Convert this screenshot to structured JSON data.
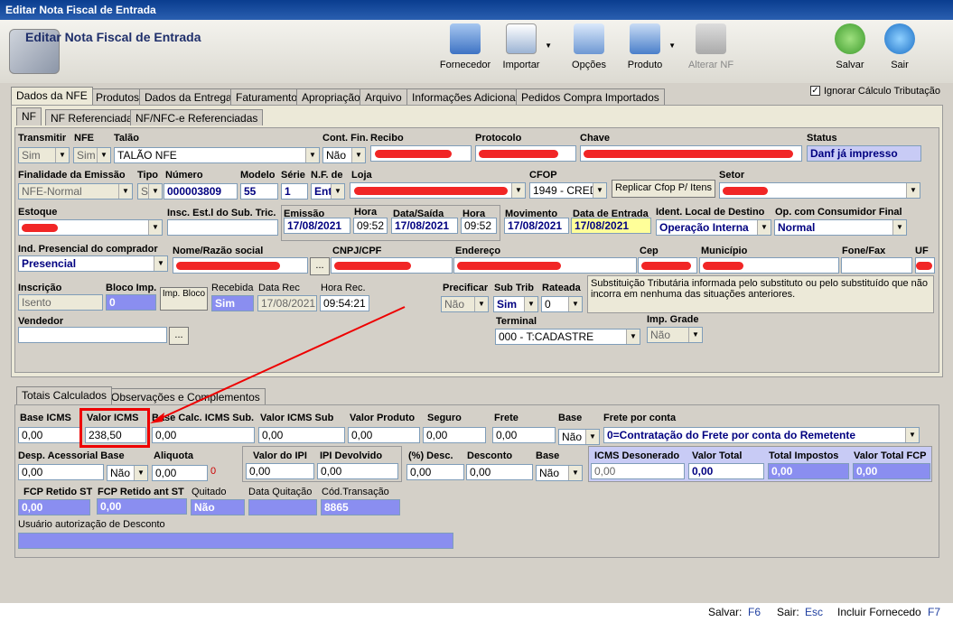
{
  "window": {
    "title": "Editar Nota Fiscal de Entrada",
    "app_name": "Editar Nota Fiscal de Entrada"
  },
  "toolbar": {
    "fornecedor": "Fornecedor",
    "importar": "Importar",
    "opcoes": "Opções",
    "produto": "Produto",
    "alterar_nf": "Alterar NF",
    "salvar": "Salvar",
    "sair": "Sair"
  },
  "main_tabs": [
    "Dados da NFE",
    "Produtos",
    "Dados da Entrega",
    "Faturamento",
    "Apropriação",
    "Arquivo",
    "Informações Adicionais",
    "Pedidos Compra Importados"
  ],
  "ignorar_calc": "Ignorar Cálculo Tributação",
  "sub_tabs": [
    "NF",
    "NF Referenciada",
    "NF/NFC-e Referenciadas"
  ],
  "labels": {
    "transmitir": "Transmitir",
    "nfe": "NFE",
    "talao": "Talão",
    "cont_fin": "Cont. Fin.",
    "recibo": "Recibo",
    "protocolo": "Protocolo",
    "chave": "Chave",
    "status": "Status",
    "finalidade": "Finalidade da Emissão",
    "tipo": "Tipo",
    "numero": "Número",
    "modelo": "Modelo",
    "serie": "Série",
    "nf_de": "N.F. de",
    "loja": "Loja",
    "cfop": "CFOP",
    "setor": "Setor",
    "estoque": "Estoque",
    "insc_sub": "Insc. Est.l do Sub. Tric.",
    "emissao": "Emissão",
    "hora": "Hora",
    "data_saida": "Data/Saída",
    "movimento": "Movimento",
    "data_entrada": "Data de Entrada",
    "ident_local": "Ident. Local de Destino",
    "op_consumidor": "Op. com Consumidor Final",
    "ind_presencial": "Ind. Presencial do comprador",
    "nome": "Nome/Razão social",
    "cnpj": "CNPJ/CPF",
    "endereco": "Endereço",
    "cep": "Cep",
    "municipio": "Município",
    "fone": "Fone/Fax",
    "uf": "UF",
    "inscricao": "Inscrição",
    "bloco_imp": "Bloco Imp.",
    "recebida": "Recebida",
    "data_rec": "Data Rec",
    "hora_rec": "Hora Rec.",
    "precificar": "Precificar",
    "sub_trib": "Sub Trib",
    "rateada": "Rateada",
    "vendedor": "Vendedor",
    "terminal": "Terminal",
    "imp_grade": "Imp. Grade"
  },
  "values": {
    "transmitir": "Sim",
    "nfe": "Sim",
    "talao": "TALÃO NFE",
    "cont_fin": "Não",
    "status": "Danf já impresso",
    "finalidade": "NFE-Normal",
    "tipo": "S",
    "numero": "000003809",
    "modelo": "55",
    "serie": "1",
    "nf_de": "Ent",
    "cfop": "1949 - CREDI",
    "emissao": "17/08/2021",
    "hora_emissao": "09:52",
    "data_saida": "17/08/2021",
    "hora_saida": "09:52",
    "movimento": "17/08/2021",
    "data_entrada": "17/08/2021",
    "ident_local": "Operação Interna",
    "op_consumidor": "Normal",
    "ind_presencial": "Presencial",
    "inscricao": "Isento",
    "bloco_imp": "0",
    "recebida": "Sim",
    "data_rec": "17/08/2021",
    "hora_rec": "09:54:21",
    "precificar": "Não",
    "sub_trib": "Sim",
    "rateada": "0",
    "terminal": "000 - T:CADASTRE",
    "imp_grade": "Não"
  },
  "buttons": {
    "replicar": "Replicar Cfop P/ Itens",
    "imp_bloco": "Imp. Bloco",
    "dots": "..."
  },
  "sub_trib_note": "Substituição Tributária informada pelo substituto ou pelo substituído que não incorra em nenhuma das situações anteriores.",
  "bottom_tabs": [
    "Totais Calculados",
    "Observações e Complementos"
  ],
  "totais": {
    "base_icms": "Base ICMS",
    "valor_icms": "Valor ICMS",
    "base_calc_sub": "Base Calc. ICMS Sub.",
    "valor_icms_sub": "Valor ICMS Sub",
    "valor_produto": "Valor Produto",
    "seguro": "Seguro",
    "frete": "Frete",
    "base": "Base",
    "frete_conta": "Frete por conta",
    "desp_acess": "Desp. Acessorial Base",
    "aliquota": "Aliquota",
    "valor_ipi": "Valor do IPI",
    "ipi_devolvido": "IPI Devolvido",
    "desc_pct": "(%) Desc.",
    "desconto": "Desconto",
    "icms_desonerado": "ICMS Desonerado",
    "valor_total": "Valor Total",
    "total_impostos": "Total Impostos",
    "valor_total_fcp": "Valor Total FCP",
    "fcp_retido": "FCP Retido ST",
    "fcp_retido_ant": "FCP Retido ant ST",
    "quitado": "Quitado",
    "data_quitacao": "Data Quitação",
    "cod_transacao": "Cód.Transação",
    "usuario_desc": "Usuário autorização de Desconto"
  },
  "totais_values": {
    "base_icms": "0,00",
    "valor_icms": "238,50",
    "base_calc_sub": "0,00",
    "valor_icms_sub": "0,00",
    "valor_produto": "0,00",
    "seguro": "0,00",
    "frete": "0,00",
    "base_frete": "Não",
    "frete_conta": "0=Contratação do Frete por conta do Remetente",
    "desp_acess": "0,00",
    "base_desp": "Não",
    "aliquota": "0,00",
    "aliquota_zero": "0",
    "valor_ipi": "0,00",
    "ipi_devolvido": "0,00",
    "desc_pct": "0,00",
    "desconto": "0,00",
    "base_desc": "Não",
    "icms_desonerado": "0,00",
    "valor_total": "0,00",
    "total_impostos": "0,00",
    "valor_total_fcp": "0,00",
    "fcp_retido": "0,00",
    "fcp_retido_ant": "0,00",
    "quitado": "Não",
    "cod_transacao": "8865"
  },
  "status_bar": {
    "salvar": "Salvar:",
    "salvar_key": "F6",
    "sair": "Sair:",
    "sair_key": "Esc",
    "incluir": "Incluir Fornecedo",
    "incluir_key": "F7"
  }
}
